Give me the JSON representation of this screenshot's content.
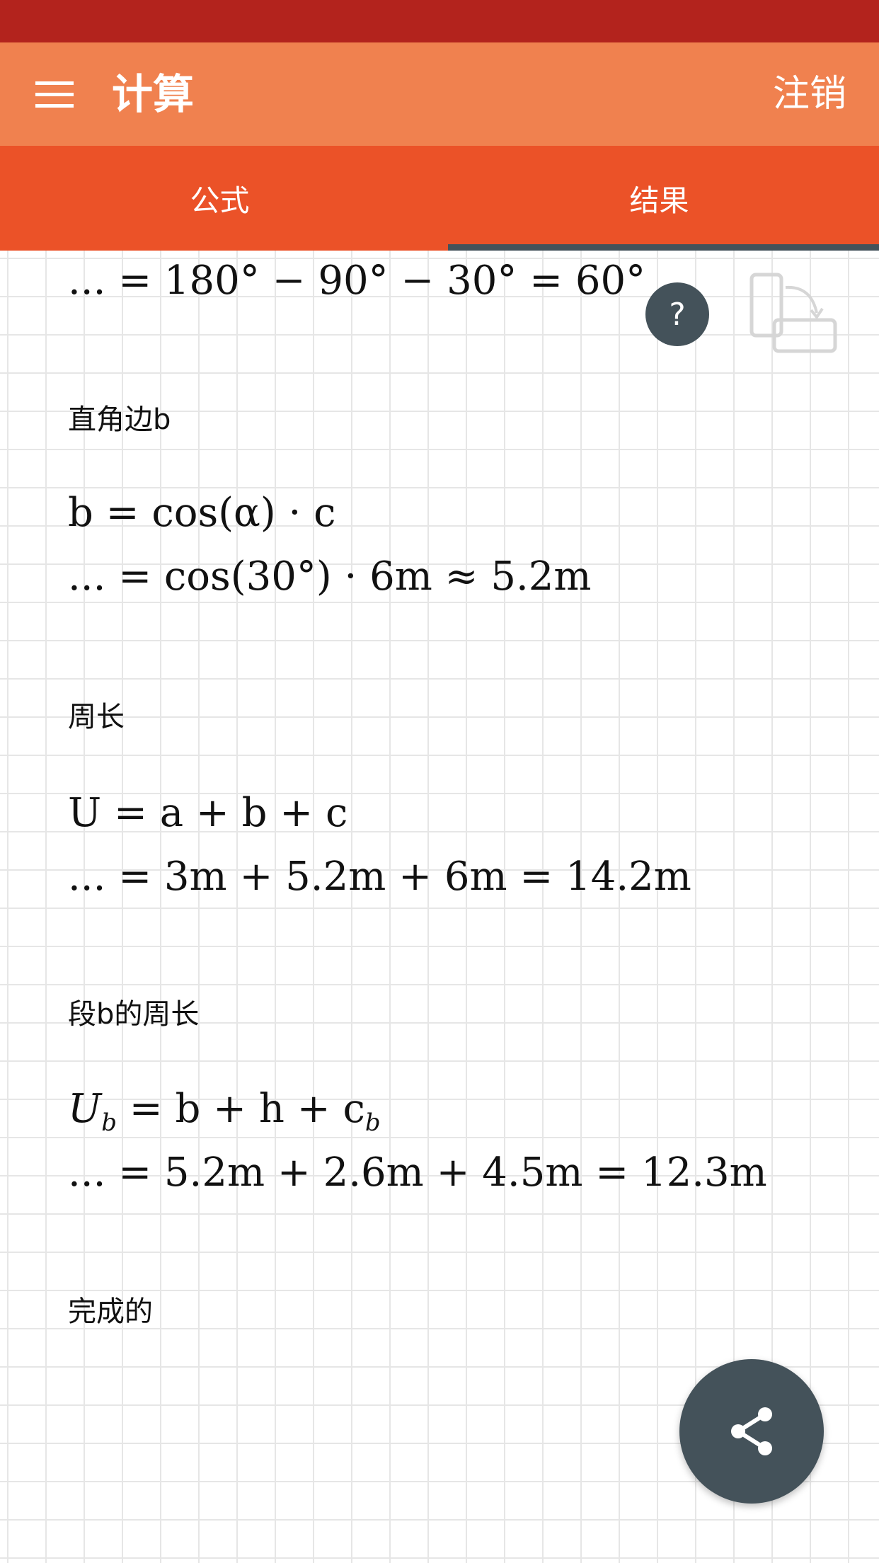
{
  "appbar": {
    "title": "计算",
    "logout_label": "注销"
  },
  "tabs": [
    {
      "label": "公式",
      "active": false
    },
    {
      "label": "结果",
      "active": true
    }
  ],
  "help": {
    "label": "?"
  },
  "sections": {
    "angle": {
      "line": "... = 180° − 90° − 30° = 60°"
    },
    "leg_b": {
      "label": "直角边b",
      "formula": "b = cos(α) · c",
      "calc": "... = cos(30°) · 6m ≈ 5.2m"
    },
    "perimeter": {
      "label": "周长",
      "formula": "U = a + b + c",
      "calc": "... = 3m + 5.2m + 6m = 14.2m"
    },
    "segment_perimeter": {
      "label": "段b的周长",
      "formula_main": "U",
      "formula_sub": "b",
      "formula_rest": " = b + h + c",
      "formula_sub2": "b",
      "calc": "... = 5.2m + 2.6m + 4.5m = 12.3m"
    },
    "done": {
      "label": "完成的"
    }
  },
  "colors": {
    "statusbar": "#b3231d",
    "appbar": "#f0814f",
    "tabbar": "#eb5228",
    "indicator": "#44525a",
    "fab": "#44525a"
  },
  "icons": {
    "menu": "menu-icon",
    "rotate": "rotate-device-icon",
    "share": "share-icon"
  }
}
